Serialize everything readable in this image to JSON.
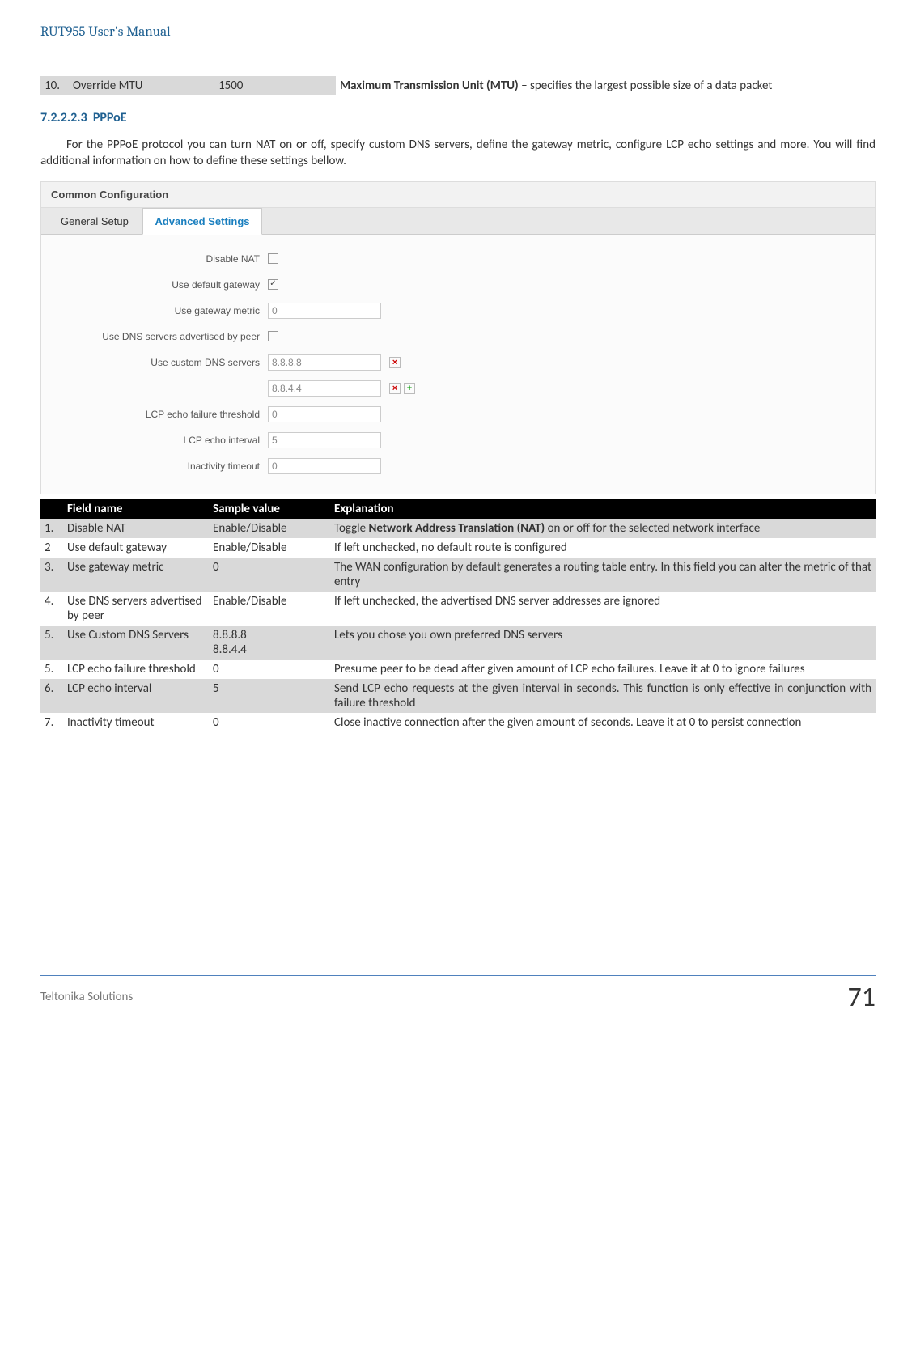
{
  "doc_title": "RUT955 User's Manual",
  "top_row": {
    "num": "10.",
    "name": "Override MTU",
    "sample": "1500",
    "exp_bold": "Maximum Transmission Unit (MTU)",
    "exp_rest": " – specifies the largest possible size of a data packet"
  },
  "section_number": "7.2.2.2.3",
  "section_title": "PPPoE",
  "body": "For the PPPoE protocol you can turn NAT on or off, specify custom DNS servers, define the gateway metric, configure LCP echo settings and more. You will find additional information on how to define these settings bellow.",
  "panel": {
    "title": "Common Configuration",
    "tabs": [
      "General Setup",
      "Advanced Settings"
    ],
    "active_tab": 1,
    "fields": {
      "disable_nat": "Disable NAT",
      "use_default_gw": "Use default gateway",
      "use_gw_metric": "Use gateway metric",
      "use_dns_peer": "Use DNS servers advertised by peer",
      "use_custom_dns": "Use custom DNS servers",
      "lcp_fail": "LCP echo failure threshold",
      "lcp_interval": "LCP echo interval",
      "inactivity": "Inactivity timeout"
    },
    "values": {
      "gw_metric": "0",
      "dns1": "8.8.8.8",
      "dns2": "8.8.4.4",
      "lcp_fail": "0",
      "lcp_interval": "5",
      "inactivity": "0"
    }
  },
  "table_headers": {
    "field": "Field name",
    "sample": "Sample value",
    "exp": "Explanation"
  },
  "rows": [
    {
      "n": "1.",
      "f": "Disable NAT",
      "s": "Enable/Disable",
      "e_pre": "Toggle ",
      "e_bold": "Network Address Translation (NAT)",
      "e_post": " on or off for the selected network interface"
    },
    {
      "n": "2",
      "f": "Use default gateway",
      "s": "Enable/Disable",
      "e": "If left unchecked, no default route is configured"
    },
    {
      "n": "3.",
      "f": "Use gateway metric",
      "s": "0",
      "e": "The WAN configuration by default generates a routing table entry. In this field you can alter the metric of that entry"
    },
    {
      "n": "4.",
      "f": "Use DNS servers advertised by peer",
      "s": "Enable/Disable",
      "e": "If left unchecked, the advertised DNS server addresses are ignored"
    },
    {
      "n": "5.",
      "f": "Use Custom DNS Servers",
      "s": "8.8.8.8\n8.8.4.4",
      "e": "Lets you chose you own preferred DNS servers"
    },
    {
      "n": "5.",
      "f": "LCP echo failure threshold",
      "s": "0",
      "e": "Presume peer to be dead after given amount of LCP echo failures. Leave it at 0 to ignore failures"
    },
    {
      "n": "6.",
      "f": "LCP echo interval",
      "s": "5",
      "e": "Send LCP echo requests at the given interval in seconds. This function is only effective in conjunction with failure threshold"
    },
    {
      "n": "7.",
      "f": "Inactivity timeout",
      "s": "0",
      "e": "Close inactive connection after the given amount of seconds. Leave it at 0 to persist connection"
    }
  ],
  "footer_left": "Teltonika Solutions",
  "footer_right": "71"
}
